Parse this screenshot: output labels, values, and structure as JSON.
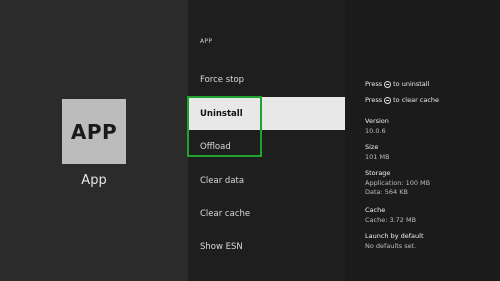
{
  "app": {
    "tile_text": "APP",
    "name": "App"
  },
  "menu": {
    "section_header": "APP",
    "items": [
      {
        "label": "Force stop"
      },
      {
        "label": "Uninstall"
      },
      {
        "label": "Offload"
      },
      {
        "label": "Clear data"
      },
      {
        "label": "Clear cache"
      },
      {
        "label": "Show ESN"
      }
    ],
    "selected_index": 1
  },
  "hints": {
    "uninstall": {
      "prefix": "Press",
      "button_icon": "minus-button-icon",
      "suffix": "to uninstall"
    },
    "clear_cache": {
      "prefix": "Press",
      "button_icon": "minus-button-icon",
      "suffix": "to clear cache"
    }
  },
  "info": {
    "version": {
      "label": "Version",
      "value": "10.0.6"
    },
    "size": {
      "label": "Size",
      "value": "101 MB"
    },
    "storage": {
      "label": "Storage",
      "application": "Application: 100 MB",
      "data": "Data: 564 KB"
    },
    "cache": {
      "label": "Cache",
      "value": "Cache: 3.72 MB"
    },
    "launch_by_default": {
      "label": "Launch by default",
      "value": "No defaults set."
    }
  },
  "colors": {
    "focus_border": "#1fa32f",
    "selected_bg": "#e8e8e8",
    "tile_bg": "#bcbcbc"
  }
}
